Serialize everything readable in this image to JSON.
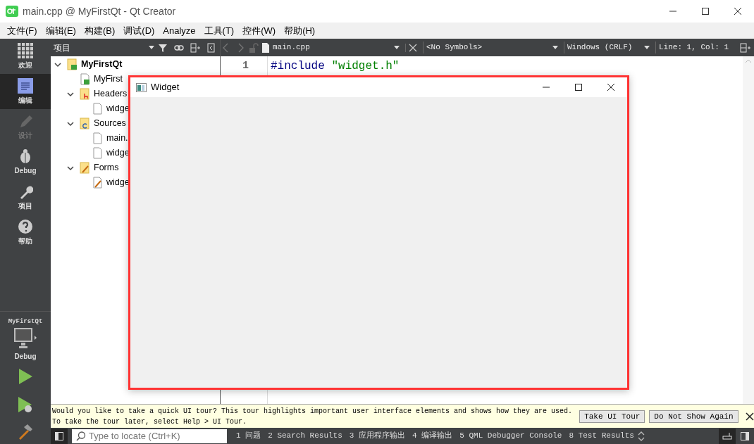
{
  "window": {
    "title": "main.cpp @ MyFirstQt - Qt Creator"
  },
  "menu": [
    {
      "label": "文件(F)"
    },
    {
      "label": "编辑(E)"
    },
    {
      "label": "构建(B)"
    },
    {
      "label": "调试(D)"
    },
    {
      "label": "Analyze"
    },
    {
      "label": "工具(T)"
    },
    {
      "label": "控件(W)"
    },
    {
      "label": "帮助(H)"
    }
  ],
  "modes": [
    {
      "label": "欢迎",
      "kind": "welcome",
      "selected": false,
      "disabled": false
    },
    {
      "label": "编辑",
      "kind": "edit",
      "selected": true,
      "disabled": false
    },
    {
      "label": "设计",
      "kind": "design",
      "selected": false,
      "disabled": true
    },
    {
      "label": "Debug",
      "kind": "debug",
      "selected": false,
      "disabled": false
    },
    {
      "label": "项目",
      "kind": "projects",
      "selected": false,
      "disabled": false
    },
    {
      "label": "帮助",
      "kind": "help",
      "selected": false,
      "disabled": false
    }
  ],
  "kit": {
    "project": "MyFirstQt",
    "build": "Debug"
  },
  "project_panel": {
    "title": "项目",
    "tree": [
      {
        "label": "MyFirstQt",
        "kind": "project",
        "expanded": true,
        "children": [
          {
            "label": "MyFirst",
            "kind": "pro"
          },
          {
            "label": "Headers",
            "kind": "headers",
            "expanded": true,
            "children": [
              {
                "label": "widge",
                "kind": "file"
              }
            ]
          },
          {
            "label": "Sources",
            "kind": "sources",
            "expanded": true,
            "children": [
              {
                "label": "main.",
                "kind": "file"
              },
              {
                "label": "widge",
                "kind": "file"
              }
            ]
          },
          {
            "label": "Forms",
            "kind": "forms",
            "expanded": true,
            "children": [
              {
                "label": "widge",
                "kind": "form"
              }
            ]
          }
        ]
      }
    ]
  },
  "editor": {
    "file": "main.cpp",
    "symbols": "<No Symbols>",
    "line_ending": "Windows (CRLF)",
    "position": "Line: 1, Col: 1",
    "lines": [
      {
        "number": "1",
        "tokens": [
          {
            "text": "#include",
            "kind": "preprocessor"
          },
          {
            "text": "\"widget.h\"",
            "kind": "string"
          }
        ]
      }
    ]
  },
  "widget_window": {
    "title": "Widget"
  },
  "info_bar": {
    "lines": [
      "Would you like to take a quick UI tour? This tour highlights important user interface elements and shows how they are used.",
      "To take the tour later, select Help > UI Tour."
    ],
    "buttons": [
      "Take UI Tour",
      "Do Not Show Again"
    ]
  },
  "status_bar": {
    "placeholder": "Type to locate (Ctrl+K)",
    "panes": [
      "1 问题",
      "2 Search Results",
      "3 应用程序输出",
      "4 编译输出",
      "5 QML Debugger Console",
      "8 Test Results"
    ]
  }
}
